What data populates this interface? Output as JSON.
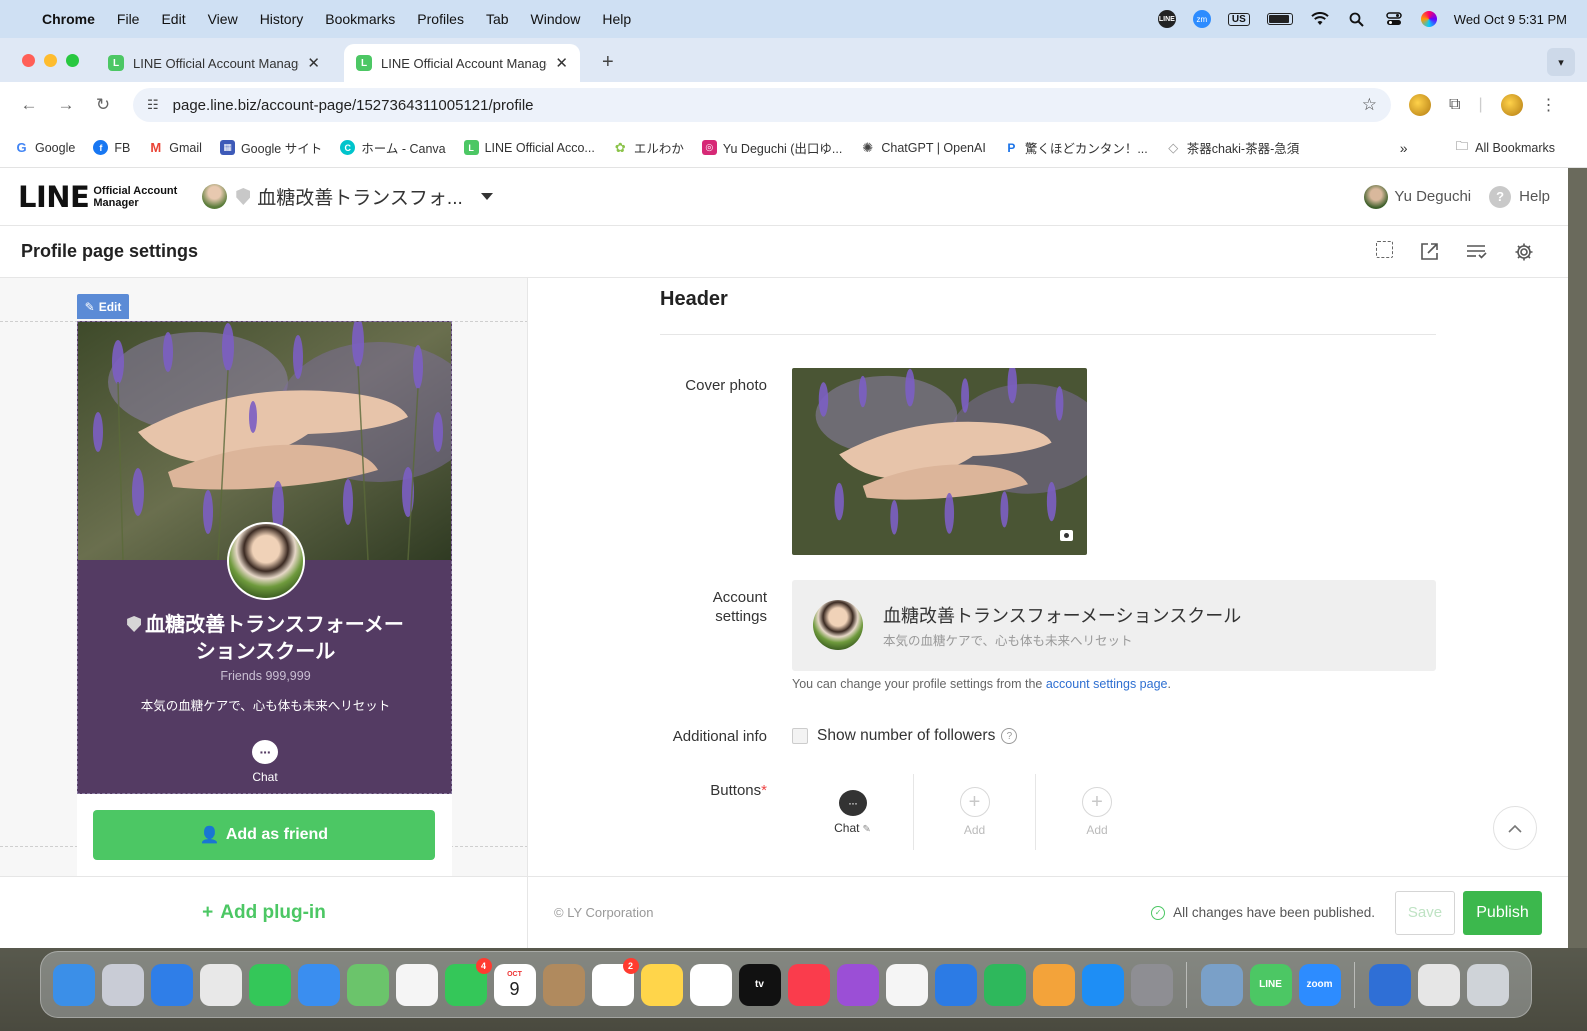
{
  "menubar": {
    "app": "Chrome",
    "items": [
      "File",
      "Edit",
      "View",
      "History",
      "Bookmarks",
      "Profiles",
      "Tab",
      "Window",
      "Help"
    ],
    "line_icon": "LINE",
    "zoom_icon": "zm",
    "input_source": "US",
    "datetime": "Wed Oct 9  5:31 PM"
  },
  "browser": {
    "tabs": [
      {
        "title": "LINE Official Account Manager",
        "favicon": "L"
      },
      {
        "title": "LINE Official Account Manager",
        "favicon": "L"
      }
    ],
    "new_tab": "+",
    "url": "page.line.biz/account-page/1527364311005121/profile",
    "bookmarks": [
      {
        "label": "Google",
        "color": "#4285f4",
        "icon": "G"
      },
      {
        "label": "FB",
        "color": "#1877f2",
        "icon": "f"
      },
      {
        "label": "Gmail",
        "color": "#ea4335",
        "icon": "M"
      },
      {
        "label": "Google サイト",
        "color": "#3d5ab8",
        "icon": "▦"
      },
      {
        "label": "ホーム - Canva",
        "color": "#00c4cc",
        "icon": "C"
      },
      {
        "label": "LINE Official Acco...",
        "color": "#4cc764",
        "icon": "L"
      },
      {
        "label": "エルわか",
        "color": "#8bc34a",
        "icon": "✿"
      },
      {
        "label": "Yu Deguchi (出口ゆ...",
        "color": "#d62976",
        "icon": "◎"
      },
      {
        "label": "ChatGPT | OpenAI",
        "color": "#444444",
        "icon": "✺"
      },
      {
        "label": "驚くほどカンタン！...",
        "color": "#1a73e8",
        "icon": "P"
      },
      {
        "label": "茶器chaki-茶器-急須",
        "color": "#999999",
        "icon": "◇"
      }
    ],
    "bookmarks_more": "»",
    "all_bookmarks": "All Bookmarks"
  },
  "app": {
    "logo": "LINE",
    "logo_sub_1": "Official Account",
    "logo_sub_2": "Manager",
    "account_name": "血糖改善トランスフォ...",
    "user_name": "Yu Deguchi",
    "help": "Help",
    "page_title": "Profile page settings"
  },
  "preview": {
    "edit_label": "Edit",
    "name": "血糖改善トランスフォーメーションスクール",
    "friends": "Friends 999,999",
    "description": "本気の血糖ケアで、心も体も未来へリセット",
    "chat_label": "Chat",
    "add_friend": "Add as friend",
    "add_plugin": "Add plug-in"
  },
  "form": {
    "section_title": "Header",
    "cover_label": "Cover photo",
    "account_label_1": "Account",
    "account_label_2": "settings",
    "account_name": "血糖改善トランスフォーメーションスクール",
    "account_desc": "本気の血糖ケアで、心も体も未来へリセット",
    "hint_prefix": "You can change your profile settings from the ",
    "hint_link": "account settings page",
    "hint_suffix": ".",
    "additional_label": "Additional info",
    "show_followers": "Show number of followers",
    "show_followers_checked": false,
    "buttons_label": "Buttons",
    "required_mark": "*",
    "button_slots": [
      {
        "label": "Chat",
        "type": "chat"
      },
      {
        "label": "Add",
        "type": "add"
      },
      {
        "label": "Add",
        "type": "add"
      }
    ]
  },
  "footer": {
    "copyright": "© LY Corporation",
    "status": "All changes have been published.",
    "save": "Save",
    "publish": "Publish"
  },
  "dock": {
    "apps": [
      {
        "name": "finder",
        "color": "#3b8fe8"
      },
      {
        "name": "launchpad",
        "color": "#c9ccd6"
      },
      {
        "name": "safari",
        "color": "#2f7ee8"
      },
      {
        "name": "chrome",
        "color": "#e8e8e8"
      },
      {
        "name": "messages",
        "color": "#34c759"
      },
      {
        "name": "mail",
        "color": "#3a8ef0"
      },
      {
        "name": "maps",
        "color": "#6bc46b"
      },
      {
        "name": "photos",
        "color": "#f5f5f5"
      },
      {
        "name": "facetime",
        "color": "#34c759",
        "badge": "4"
      },
      {
        "name": "calendar",
        "color": "#ffffff",
        "label_top": "OCT",
        "label": "9"
      },
      {
        "name": "contacts",
        "color": "#b08a5e"
      },
      {
        "name": "reminders",
        "color": "#ffffff",
        "badge": "2"
      },
      {
        "name": "notes",
        "color": "#ffd54a"
      },
      {
        "name": "freeform",
        "color": "#ffffff"
      },
      {
        "name": "tv",
        "color": "#111111",
        "label": "tv"
      },
      {
        "name": "music",
        "color": "#fa3c4c"
      },
      {
        "name": "podcasts",
        "color": "#9b4fd6"
      },
      {
        "name": "news",
        "color": "#f5f5f5"
      },
      {
        "name": "keynote",
        "color": "#2c7be5"
      },
      {
        "name": "numbers",
        "color": "#2eb85c"
      },
      {
        "name": "pages",
        "color": "#f3a33a"
      },
      {
        "name": "app-store",
        "color": "#1e8ef5"
      },
      {
        "name": "system-settings",
        "color": "#8e8e93"
      }
    ],
    "apps2": [
      {
        "name": "preview",
        "color": "#7aa0c8"
      },
      {
        "name": "line",
        "color": "#4cc764",
        "label": "LINE"
      },
      {
        "name": "zoom",
        "color": "#2d8cff",
        "label": "zoom"
      }
    ],
    "apps3": [
      {
        "name": "network-globe",
        "color": "#2f6fd6"
      },
      {
        "name": "jpeg-file",
        "color": "#e6e6e6"
      },
      {
        "name": "trash",
        "color": "#cfd3d8"
      }
    ]
  }
}
